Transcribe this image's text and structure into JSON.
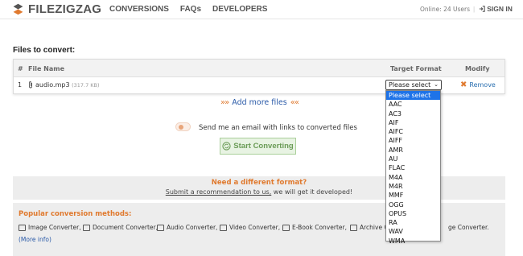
{
  "header": {
    "logo_text": "FILEZIGZAG",
    "nav": [
      "CONVERSIONS",
      "FAQs",
      "DEVELOPERS"
    ],
    "online": "Online: 24 Users",
    "signin": "SIGN IN"
  },
  "files": {
    "title": "Files to convert:",
    "columns": {
      "num": "#",
      "name": "File Name",
      "target": "Target Format",
      "modify": "Modify"
    },
    "row": {
      "num": "1",
      "name": "audio.mp3",
      "size": "(317.7 KB)",
      "selected": "Please select",
      "remove": "Remove"
    }
  },
  "add_more": "Add more files",
  "add_more_arrows_left": "»»",
  "add_more_arrows_right": "««",
  "email_label": "Send me an email with links to converted files",
  "start_button": "Start Converting",
  "different": {
    "title": "Need a different format?",
    "link": "Submit a recommendation to us,",
    "rest": " we will get it developed!"
  },
  "popular": {
    "title": "Popular conversion methods:",
    "items": [
      "Image Converter,",
      "Document Converter,",
      "Audio Converter,",
      "Video Converter,",
      "E-Book Converter,",
      "Archive Conv",
      "ge Converter."
    ],
    "more": "(More info)"
  },
  "dropdown": {
    "options": [
      "Please select",
      "AAC",
      "AC3",
      "AIF",
      "AIFC",
      "AIFF",
      "AMR",
      "AU",
      "FLAC",
      "M4A",
      "M4R",
      "MMF",
      "OGG",
      "OPUS",
      "RA",
      "WAV",
      "WMA"
    ],
    "active_index": 0
  },
  "colors": {
    "accent": "#e07a2f",
    "link": "#2a5aa8",
    "green": "#6a9b56",
    "highlight": "#1e73e8"
  }
}
